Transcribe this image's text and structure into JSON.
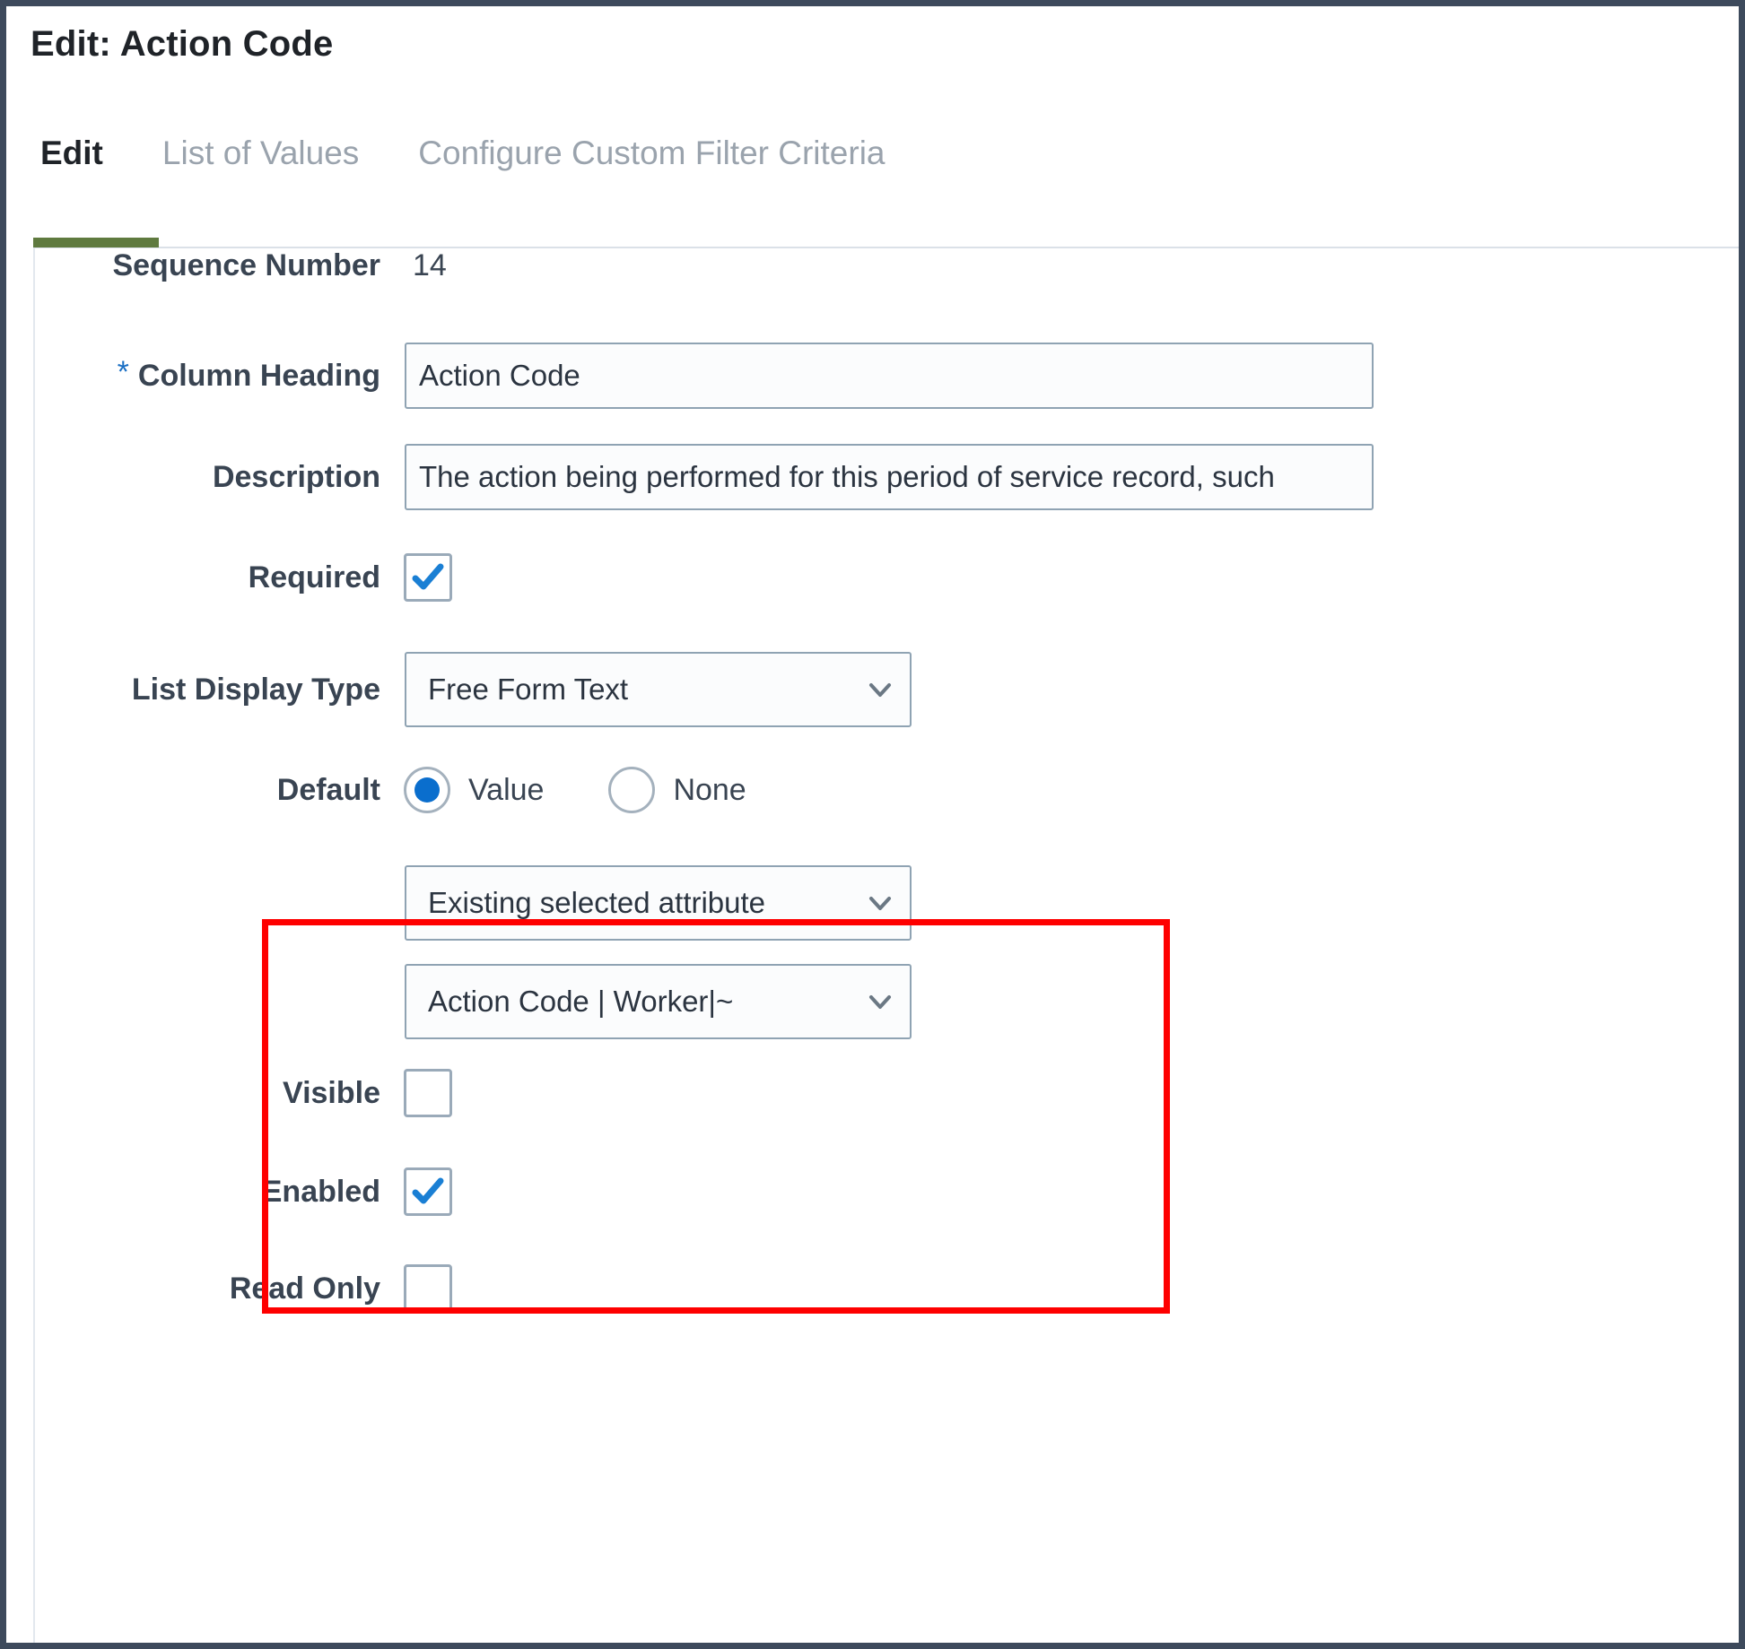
{
  "window": {
    "title": "Edit: Action Code"
  },
  "tabs": [
    {
      "label": "Edit",
      "active": true
    },
    {
      "label": "List of Values",
      "active": false
    },
    {
      "label": "Configure Custom Filter Criteria",
      "active": false
    }
  ],
  "form": {
    "sequence_number": {
      "label": "Sequence Number",
      "value": "14"
    },
    "column_heading": {
      "label": "Column Heading",
      "required_marker": "*",
      "value": "Action Code"
    },
    "description": {
      "label": "Description",
      "value": "The action being performed for this period of service record, such"
    },
    "required": {
      "label": "Required",
      "checked": "true"
    },
    "list_display_type": {
      "label": "List Display Type",
      "value": "Free Form Text"
    },
    "default": {
      "label": "Default",
      "options": [
        "Value",
        "None"
      ],
      "selected": "Value",
      "option_value_label": "Value",
      "option_none_label": "None",
      "source_select": {
        "value": "Existing selected attribute"
      },
      "attribute_select": {
        "value": "Action Code | Worker|~"
      }
    },
    "visible": {
      "label": "Visible",
      "checked": "false"
    },
    "enabled": {
      "label": "Enabled",
      "checked": "true"
    },
    "read_only": {
      "label": "Read Only",
      "checked": "false"
    }
  },
  "colors": {
    "accent_tab_underline": "#5f7a3f",
    "required_asterisk": "#1a6fc4",
    "checkbox_check": "#1a7fd4",
    "radio_dot": "#0a6ecd",
    "highlight_box": "#fe0000",
    "window_border": "#3d4a5c",
    "label_text": "#394452"
  },
  "icons": {
    "chevron_down": "chevron-down-icon",
    "checkmark": "checkmark-icon"
  }
}
